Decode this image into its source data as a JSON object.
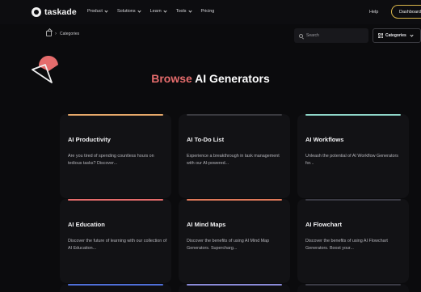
{
  "nav": {
    "logo": "taskade",
    "items": [
      {
        "label": "Product",
        "dropdown": true
      },
      {
        "label": "Solutions",
        "dropdown": true
      },
      {
        "label": "Learn",
        "dropdown": true
      },
      {
        "label": "Tools",
        "dropdown": true
      },
      {
        "label": "Pricing",
        "dropdown": false
      }
    ],
    "help": "Help",
    "dashboard": "Dashboard"
  },
  "toolbar": {
    "breadcrumb": "Categories",
    "search_placeholder": "Search",
    "categories_label": "Categories"
  },
  "page": {
    "heading_accent": "Browse",
    "heading_rest": " AI Generators"
  },
  "colors": {
    "accent": "#e56c6c",
    "dashboard_border": "#d9b64a"
  },
  "cards": [
    {
      "title": "AI Productivity",
      "desc": "Are you tired of spending countless hours on tedious tasks? Discover...",
      "bar": "#e6a86a"
    },
    {
      "title": "AI To-Do List",
      "desc": "Experience a breakthrough in task management with our AI-powered...",
      "bar": "#3a3a3f"
    },
    {
      "title": "AI Workflows",
      "desc": "Unleash the potential of AI Workflow Generators for...",
      "bar": "#8fd6c8"
    },
    {
      "title": "AI Education",
      "desc": "Discover the future of learning with our collection of AI Education...",
      "bar": "#e56c6c"
    },
    {
      "title": "AI Mind Maps",
      "desc": "Discover the benefits of using AI Mind Map Generators. Supercharg...",
      "bar": "#e0795a"
    },
    {
      "title": "AI Flowchart",
      "desc": "Discover the benefits of using AI Flowchart Generators. Boost your...",
      "bar": "#3a3a44"
    }
  ],
  "bottom_bars": [
    "#4f6fd8",
    "#8a8ad8",
    "#3a3a44"
  ]
}
